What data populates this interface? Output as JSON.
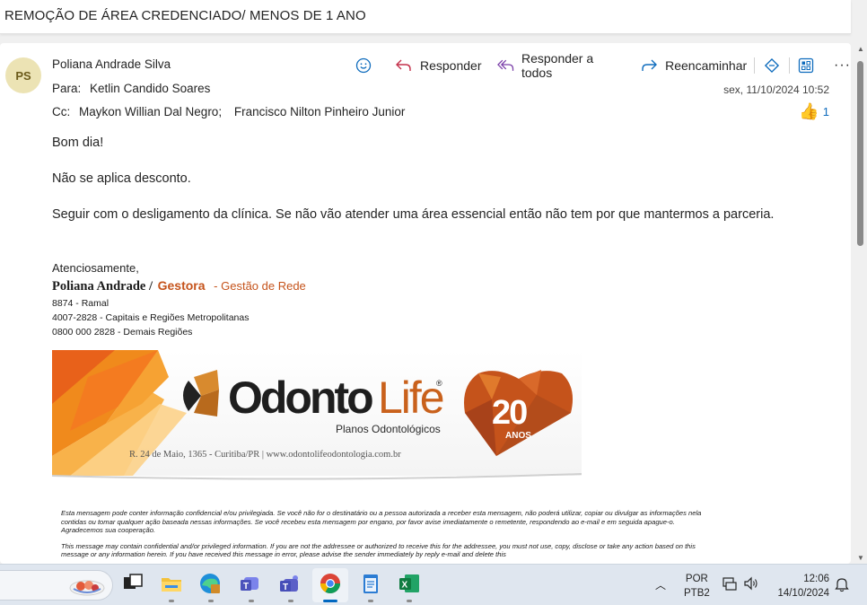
{
  "subject": "REMOÇÃO DE ÁREA CREDENCIADO/ MENOS DE 1 ANO",
  "message": {
    "avatar_initials": "PS",
    "from": "Poliana Andrade Silva",
    "to_label": "Para:",
    "to": "Ketlin Candido Soares",
    "cc_label": "Cc:",
    "cc": [
      "Maykon Willian Dal Negro;",
      "Francisco Nilton Pinheiro Junior"
    ],
    "date": "sex, 11/10/2024 10:52",
    "reaction_count": "1",
    "actions": {
      "reply": "Responder",
      "reply_all": "Responder a todos",
      "forward": "Reencaminhar",
      "more": "···"
    },
    "body": [
      "Bom dia!",
      "Não se aplica desconto.",
      "Seguir com o desligamento da clínica. Se não vão atender uma área essencial então não tem por que mantermos a parceria."
    ]
  },
  "signature": {
    "closing": "Atenciosamente,",
    "name": "Poliana Andrade /",
    "role": "Gestora",
    "department": "- Gestão de Rede",
    "phones": [
      "8874 - Ramal",
      "4007-2828 - Capitais e Regiões Metropolitanas",
      "0800 000 2828 - Demais Regiões"
    ]
  },
  "banner": {
    "logo_text_main": "Odonto",
    "logo_text_accent": "Life",
    "registered_mark": "®",
    "tagline": "Planos Odontológicos",
    "address": "R. 24 de Maio, 1365 - Curitiba/PR  |  www.odontolifeodontologia.com.br",
    "badge_number": "20",
    "badge_text": "ANOS"
  },
  "disclaimer": {
    "pt": "Esta mensagem pode conter informação confidencial e/ou privilegiada. Se você não for o destinatário ou a pessoa autorizada a receber esta mensagem, não poderá utilizar, copiar ou divulgar as informações nela contidas ou tomar qualquer ação baseada nessas informações. Se você recebeu esta mensagem por engano, por favor avise imediatamente o remetente, respondendo ao e-mail e em seguida apague-o. Agradecemos sua cooperação.",
    "en": "This message may contain confidential and/or privileged information. If you are not the addressee or authorized to receive this for the addressee, you must not use, copy, disclose or take any action based on this message or any information herein. If you have received this message in error, please advise the sender immediately by reply e-mail and delete this"
  },
  "taskbar": {
    "lang_line1": "POR",
    "lang_line2": "PTB2",
    "time": "12:06",
    "date": "14/10/2024"
  },
  "colors": {
    "accent_orange": "#c5531b",
    "link_blue": "#0f6cbd"
  }
}
